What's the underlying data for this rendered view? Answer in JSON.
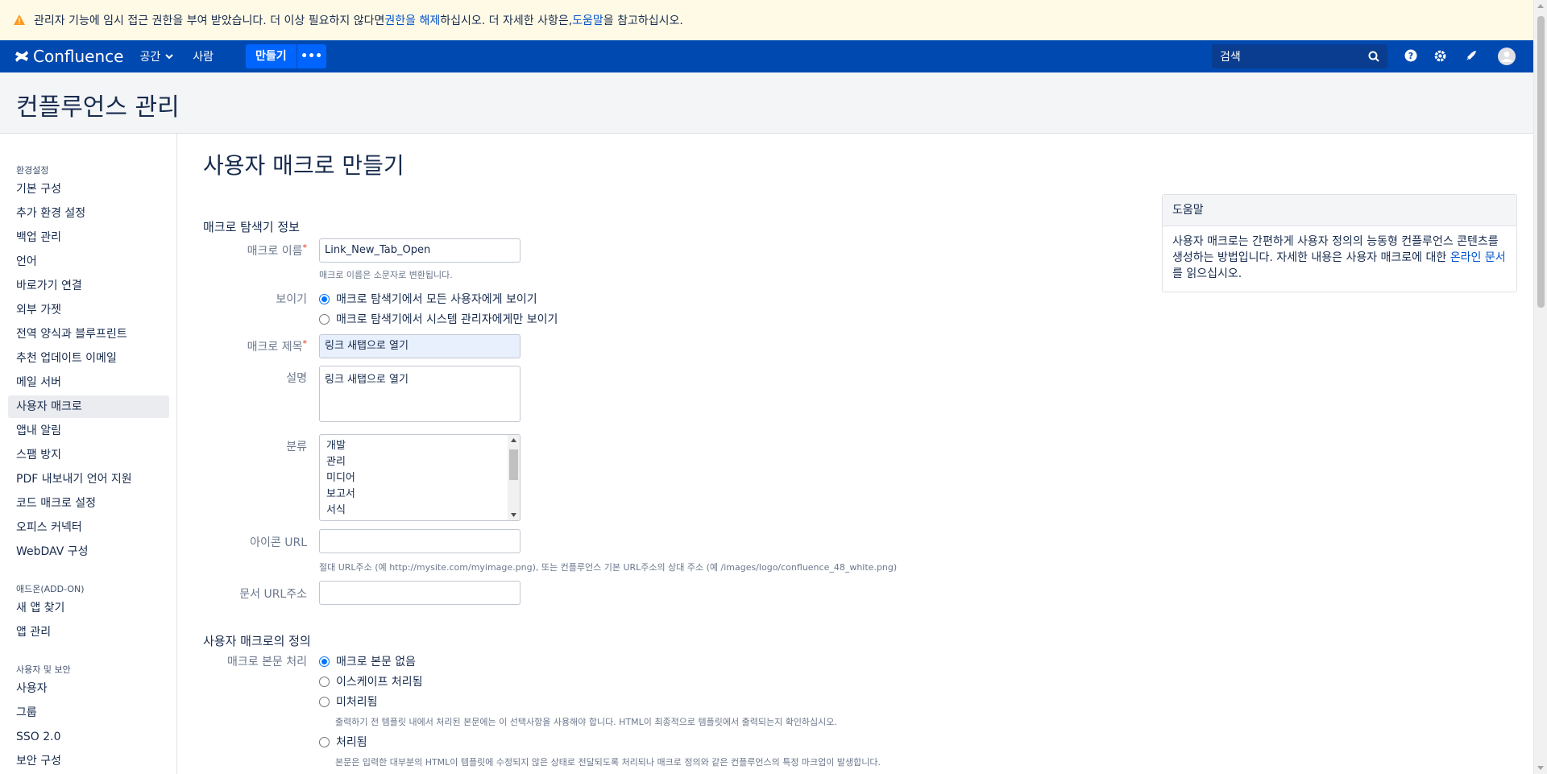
{
  "banner": {
    "text_before": "관리자 기능에 임시 접근 권한을 부여 받았습니다. 더 이상 필요하지 않다면 ",
    "link1": "권한을 해제",
    "text_middle": "하십시오. 더 자세한 사항은, ",
    "link2": "도움말",
    "text_after": "을 참고하십시오.",
    "icon": "warning-icon"
  },
  "header": {
    "brand": "Confluence",
    "nav_spaces": "공간",
    "nav_people": "사람",
    "create": "만들기",
    "more": "•••",
    "search_placeholder": "검색",
    "icons": [
      "help-icon",
      "gear-icon",
      "notification-icon",
      "user-avatar-icon"
    ]
  },
  "page": {
    "admin_title": "컨플루언스 관리",
    "title": "사용자 매크로 만들기"
  },
  "sidebar": {
    "groups": [
      {
        "heading": "환경설정",
        "items": [
          "기본 구성",
          "추가 환경 설정",
          "백업 관리",
          "언어",
          "바로가기 연결",
          "외부 가젯",
          "전역 양식과 블루프린트",
          "추천 업데이트 이메일",
          "메일 서버",
          "사용자 매크로",
          "앱내 알림",
          "스팸 방지",
          "PDF 내보내기 언어 지원",
          "코드 매크로 설정",
          "오피스 커넥터",
          "WebDAV 구성"
        ]
      },
      {
        "heading": "애드온(ADD-ON)",
        "items": [
          "새 앱 찾기",
          "앱 관리"
        ]
      },
      {
        "heading": "사용자 및 보안",
        "items": [
          "사용자",
          "그룹",
          "SSO 2.0",
          "보안 구성"
        ]
      }
    ],
    "active": "사용자 매크로"
  },
  "form": {
    "section1": "매크로 탐색기 정보",
    "macro_name_label": "매크로 이름",
    "macro_name_value": "Link_New_Tab_Open",
    "macro_name_hint": "매크로 이름은 소문자로 변환됩니다.",
    "visibility_label": "보이기",
    "visibility_opt1": "매크로 탐색기에서 모든 사용자에게 보이기",
    "visibility_opt2": "매크로 탐색기에서 시스템 관리자에게만 보이기",
    "macro_title_label": "매크로 제목",
    "macro_title_value": "링크 새탭으로 열기",
    "description_label": "설명",
    "description_value": "링크 새탭으로 열기",
    "category_label": "분류",
    "categories": [
      "개발",
      "관리",
      "미디어",
      "보고서",
      "서식"
    ],
    "icon_url_label": "아이콘 URL",
    "icon_url_hint": "절대 URL주소 (예 http://mysite.com/myimage.png), 또는 컨플루언스 기본 URL주소의 상대 주소 (예 /images/logo/confluence_48_white.png)",
    "doc_url_label": "문서 URL주소",
    "section2": "사용자 매크로의 정의",
    "body_label": "매크로 본문 처리",
    "body_opt1": "매크로 본문 없음",
    "body_opt2": "이스케이프 처리됨",
    "body_opt3": "미처리됨",
    "body_opt3_hint": "출력하기 전 템플릿 내에서 처리된 본문에는 이 선택사항을 사용해야 합니다. HTML이 최종적으로 템플릿에서 출력되는지 확인하십시오.",
    "body_opt4": "처리됨",
    "body_opt4_hint": "본문은 입력한 대부분의 HTML이 템플릿에 수정되지 않은 상태로 전달되도록 처리되나 매크로 정의와 같은 컨플루언스의 특정 마크업이 발생합니다."
  },
  "help": {
    "heading": "도움말",
    "text": "사용자 매크로는 간편하게 사용자 정의의 능동형 컨플루언스 콘텐츠를 생성하는 방법입니다. 자세한 내용은 사용자 매크로에 대한 ",
    "link": "온라인 문서",
    "text_after": "를 읽으십시오."
  },
  "colors": {
    "header": "#0049b0",
    "banner": "#fffae6",
    "link": "#0052cc",
    "create_button": "#0065ff"
  }
}
